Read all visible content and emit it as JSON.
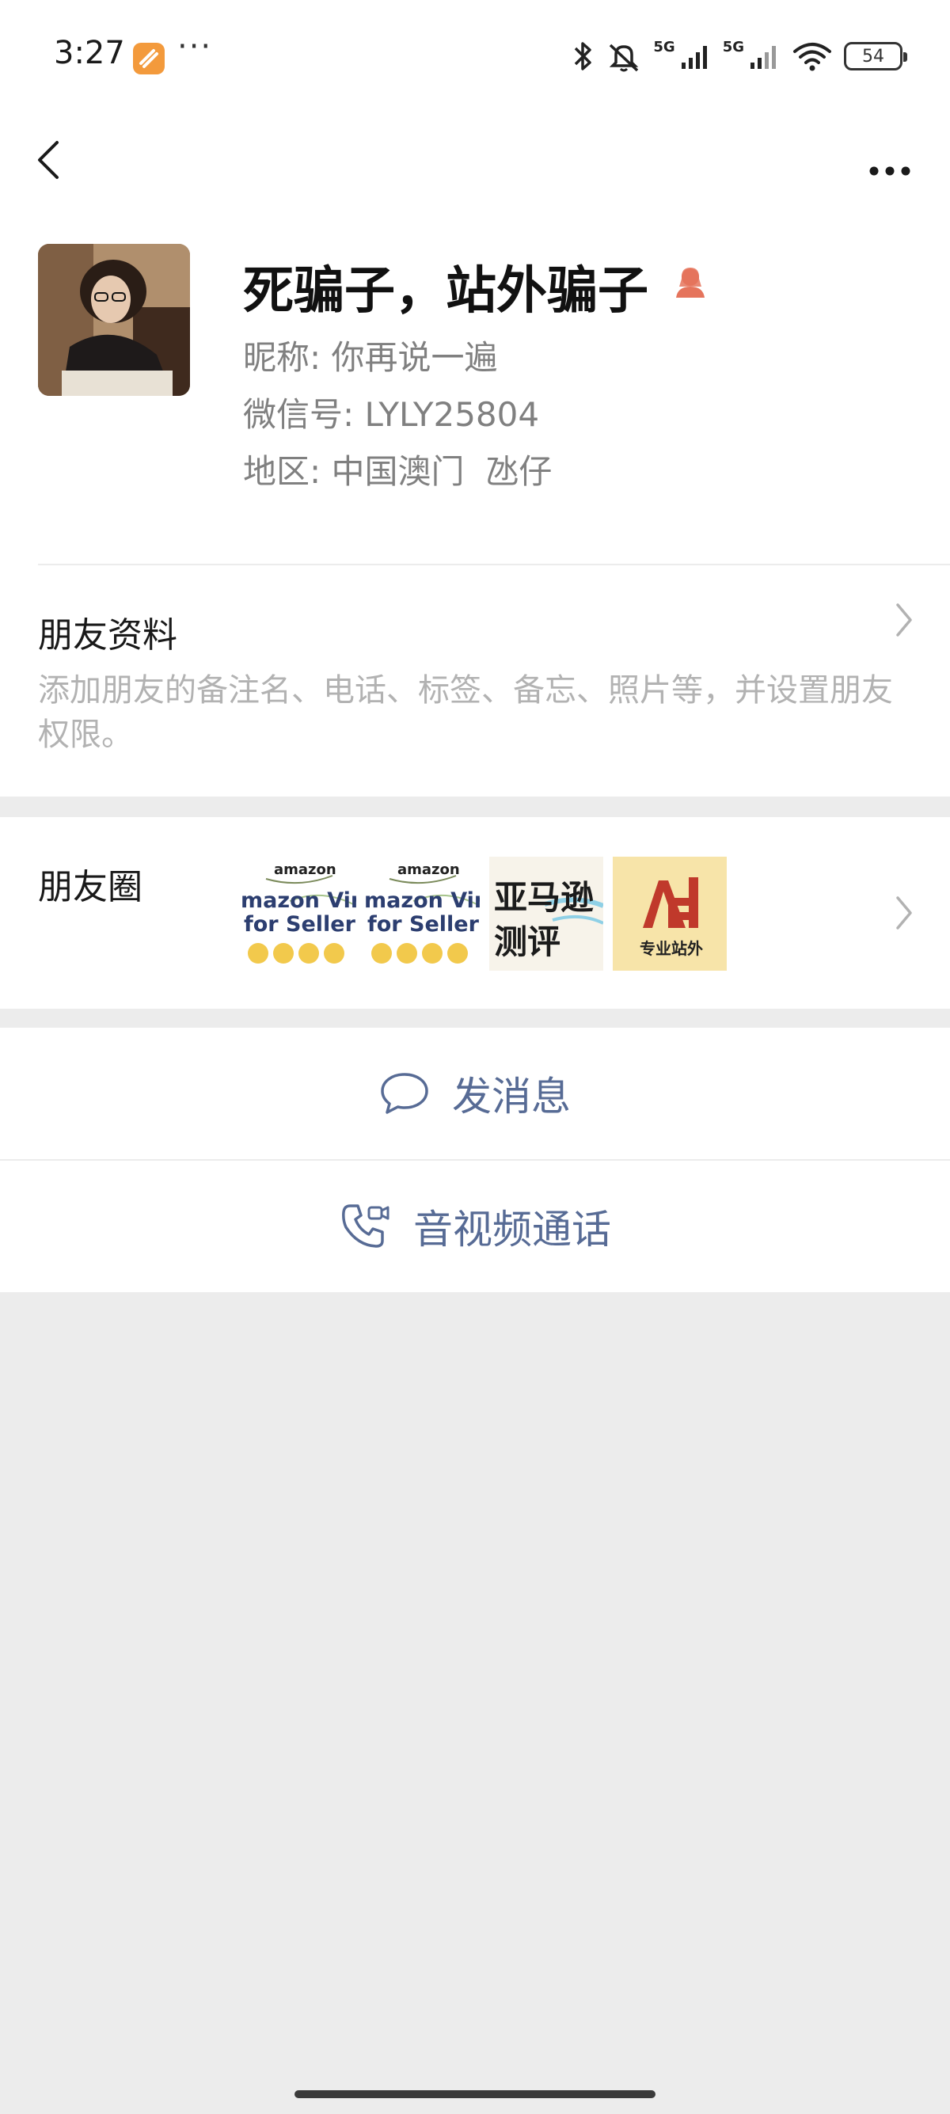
{
  "status_bar": {
    "time": "3:27",
    "more": "···",
    "signal_1_label": "5G",
    "signal_2_label": "5G",
    "battery": "54",
    "icons": [
      "app-icon",
      "bluetooth-icon",
      "mute-icon",
      "signal-icon",
      "wifi-icon",
      "battery-icon"
    ]
  },
  "nav": {
    "back_icon": "chevron-left-icon",
    "menu_icon": "more-horizontal-icon"
  },
  "profile": {
    "display_name": "死骗子，站外骗子",
    "gender_icon": "female-icon",
    "nickname_label": "昵称:",
    "nickname": "你再说一遍",
    "wechat_id_label": "微信号:",
    "wechat_id": "LYLY25804",
    "region_label": "地区:",
    "region": "中国澳门  氹仔"
  },
  "friend_info": {
    "title": "朋友资料",
    "description": "添加朋友的备注名、电话、标签、备忘、照片等，并设置朋友权限。"
  },
  "moments": {
    "title": "朋友圈",
    "thumbnails": [
      {
        "brand": "amazon",
        "line1": "mazon Vine",
        "line2": "for Sellers"
      },
      {
        "brand": "amazon",
        "line1": "mazon Vine",
        "line2": "for Sellers"
      },
      {
        "line1": "亚马逊",
        "line2": "测评"
      },
      {
        "line1": "专业站外"
      }
    ]
  },
  "actions": {
    "message": "发消息",
    "call": "音视频通话"
  },
  "colors": {
    "link_blue": "#576b95",
    "background": "#ececec",
    "hint_gray": "#b2b2b2",
    "gender_female": "#e5745c"
  }
}
